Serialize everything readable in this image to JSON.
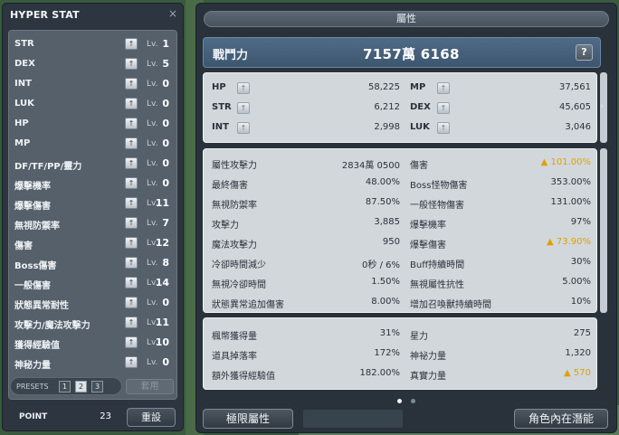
{
  "hyper_stat": {
    "title": "HYPER STAT",
    "close_icon": "×",
    "level_prefix": "Lv.",
    "up_icon": "↑",
    "rows": [
      {
        "name": "STR",
        "level": "1"
      },
      {
        "name": "DEX",
        "level": "5"
      },
      {
        "name": "INT",
        "level": "0"
      },
      {
        "name": "LUK",
        "level": "0"
      },
      {
        "name": "HP",
        "level": "0"
      },
      {
        "name": "MP",
        "level": "0"
      },
      {
        "name": "DF/TF/PP/靈力",
        "level": "0"
      },
      {
        "name": "爆擊機率",
        "level": "0"
      },
      {
        "name": "爆擊傷害",
        "level": "11"
      },
      {
        "name": "無視防禦率",
        "level": "7"
      },
      {
        "name": "傷害",
        "level": "12"
      },
      {
        "name": "Boss傷害",
        "level": "8"
      },
      {
        "name": "一般傷害",
        "level": "14"
      },
      {
        "name": "狀態異常耐性",
        "level": "0"
      },
      {
        "name": "攻擊力/魔法攻擊力",
        "level": "11"
      },
      {
        "name": "獲得經驗值",
        "level": "10"
      },
      {
        "name": "神秘力量",
        "level": "0"
      }
    ],
    "presets_label": "PRESETS",
    "presets": [
      "1",
      "2",
      "3"
    ],
    "active_preset": "2",
    "apply_label": "套用",
    "point_label": "POINT",
    "point_value": "23",
    "reset_label": "重設"
  },
  "attributes": {
    "title": "屬性",
    "combat_power_label": "戰鬥力",
    "combat_power_value": "7157萬 6168",
    "help_label": "?",
    "arrow_icon": "›",
    "up_icon": "↑",
    "base_stats": [
      {
        "name": "HP",
        "value": "58,225"
      },
      {
        "name": "MP",
        "value": "37,561"
      },
      {
        "name": "STR",
        "value": "6,212"
      },
      {
        "name": "DEX",
        "value": "45,605"
      },
      {
        "name": "INT",
        "value": "2,998"
      },
      {
        "name": "LUK",
        "value": "3,046"
      }
    ],
    "detail_stats": [
      {
        "name": "屬性攻擊力",
        "value": "2834萬 0500"
      },
      {
        "name": "傷害",
        "value": "▲ 101.00%"
      },
      {
        "name": "最終傷害",
        "value": "48.00%"
      },
      {
        "name": "Boss怪物傷害",
        "value": "353.00%"
      },
      {
        "name": "無視防禦率",
        "value": "87.50%"
      },
      {
        "name": "一般怪物傷害",
        "value": "131.00%"
      },
      {
        "name": "攻擊力",
        "value": "3,885"
      },
      {
        "name": "爆擊機率",
        "value": "97%"
      },
      {
        "name": "魔法攻擊力",
        "value": "950"
      },
      {
        "name": "爆擊傷害",
        "value": "▲ 73.90%"
      },
      {
        "name": "冷卻時間減少",
        "value": "0秒 / 6%"
      },
      {
        "name": "Buff持續時間",
        "value": "30%"
      },
      {
        "name": "無視冷卻時間",
        "value": "1.50%"
      },
      {
        "name": "無視屬性抗性",
        "value": "5.00%"
      },
      {
        "name": "狀態異常追加傷害",
        "value": "8.00%"
      },
      {
        "name": "增加召喚獸持續時間",
        "value": "10%"
      }
    ],
    "extra_stats": [
      {
        "name": "楓幣獲得量",
        "value": "31%"
      },
      {
        "name": "星力",
        "value": "275"
      },
      {
        "name": "道具掉落率",
        "value": "172%"
      },
      {
        "name": "神祕力量",
        "value": "1,320"
      },
      {
        "name": "額外獲得經驗值",
        "value": "182.00%"
      },
      {
        "name": "真實力量",
        "value": "▲ 570"
      }
    ],
    "limit_button": "極限屬性",
    "inner_ability_button": "角色內在潛能"
  },
  "colors": {
    "panel_dark": "#2d3640",
    "stat_box": "#d2d7dc",
    "power_bar": "#4a6580",
    "gold_increase": "#e0a000"
  }
}
